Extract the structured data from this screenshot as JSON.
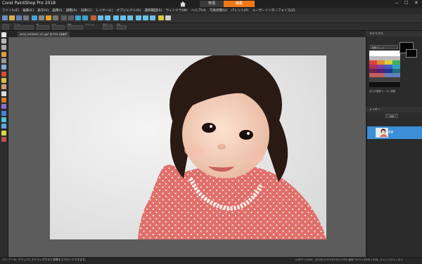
{
  "app": {
    "title": "Corel PaintShop Pro 2018",
    "tabs": [
      {
        "label": "管理",
        "active": false
      },
      {
        "label": "編集",
        "active": true
      }
    ],
    "accent_color": "#f07818",
    "window_controls": {
      "minimize": "—",
      "maximize": "□",
      "close": "✕"
    }
  },
  "menu": [
    "ファイル(F)",
    "編集(E)",
    "表示(V)",
    "画像(I)",
    "調整(A)",
    "効果(C)",
    "レイヤー(L)",
    "オブジェクト(O)",
    "選択範囲(S)",
    "ウィンドウ(W)",
    "ヘルプ(H)",
    "写真修整(U)",
    "パレット(P)",
    "ユーザーインターフェイス(Z)"
  ],
  "options_bar": {
    "labels": [
      "プリセット:",
      "モード:",
      "幅:",
      "高さ:",
      "単位:",
      "オプション",
      "表示モード:",
      "表示:"
    ]
  },
  "document": {
    "tab_label": "2016_10160407_01.jpg* @ 25% (背景)",
    "close_glyph": "✕"
  },
  "materials": {
    "title": "マテリアル",
    "palette_label": "標準パレット",
    "foreground_color": "#050505",
    "background_color": "#050505",
    "all_tools_label": "全ての選択ツールに適用"
  },
  "layers": {
    "title": "レイヤー",
    "opacity": "100",
    "layer_name": "背景",
    "row_color": "#3b8fd6"
  },
  "status": {
    "left": "パン ツール: クリックしてドラッグすると画像をスクロールできます。",
    "right": "x:4937 y:3426 – (R:255,G:255,B:255,O:255) 画像: 5472 x 3648 x RGB – 8 ビット/チャンネル"
  }
}
